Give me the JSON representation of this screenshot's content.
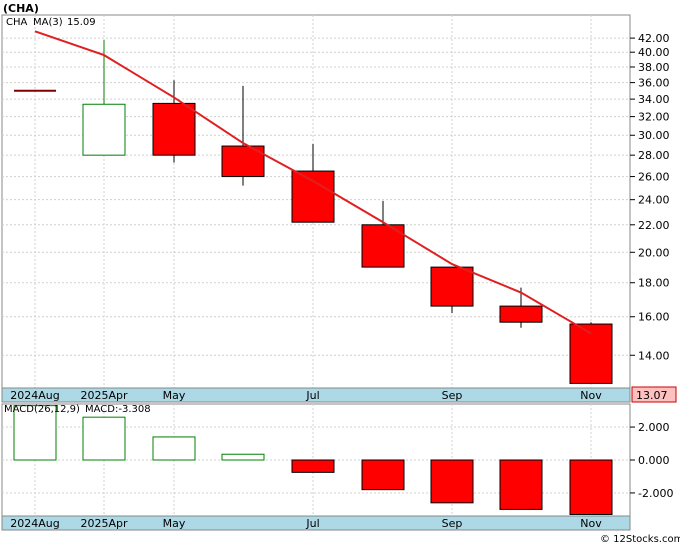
{
  "header": {
    "title": "(CHA)",
    "symbol": "CHA",
    "ma_label": "MA(3)",
    "ma_value": "15.09",
    "last_price": "13.07",
    "macd_label": "MACD(26,12,9)",
    "macd_value_label": "MACD:-3.308",
    "watermark": "© 12Stocks.com"
  },
  "colors": {
    "up_candle": "#ffffff",
    "up_border": "#008000",
    "down_candle": "#ff0000",
    "ma_line": "#e02020",
    "axis_strip": "#add8e6",
    "price_tag": "#ffc0c0",
    "grid": "#d0d0d0"
  },
  "chart_data": [
    {
      "type": "candlestick",
      "title": "(CHA)",
      "period_labels": [
        "2024Aug",
        "2025Apr",
        "May",
        "Jul",
        "Sep",
        "Nov"
      ],
      "ylim": [
        12.5,
        45.5
      ],
      "y_scale": "log",
      "y_ticks": [
        "14.00",
        "16.00",
        "18.00",
        "20.00",
        "22.00",
        "24.00",
        "26.00",
        "28.00",
        "30.00",
        "32.00",
        "34.00",
        "36.00",
        "38.00",
        "40.00",
        "42.00"
      ],
      "grid": true,
      "candles": [
        {
          "open": 35.0,
          "close": 35.0,
          "high": 35.0,
          "low": 35.0
        },
        {
          "open": 28.0,
          "close": 33.4,
          "high": 41.7,
          "low": 28.0
        },
        {
          "open": 33.5,
          "close": 28.0,
          "high": 36.3,
          "low": 27.3
        },
        {
          "open": 28.9,
          "close": 26.0,
          "high": 35.6,
          "low": 25.2
        },
        {
          "open": 26.5,
          "close": 22.2,
          "high": 29.1,
          "low": 22.2
        },
        {
          "open": 22.0,
          "close": 19.0,
          "high": 23.9,
          "low": 19.0
        },
        {
          "open": 19.0,
          "close": 16.6,
          "high": 19.0,
          "low": 16.2
        },
        {
          "open": 16.6,
          "close": 15.7,
          "high": 17.7,
          "low": 15.4
        },
        {
          "open": 15.6,
          "close": 12.7,
          "high": 15.7,
          "low": 12.7
        }
      ],
      "ma_series": {
        "name": "MA(3)",
        "points": [
          [
            0,
            43.0
          ],
          [
            1,
            39.6
          ],
          [
            2,
            34.2
          ],
          [
            3,
            29.2
          ],
          [
            4,
            25.6
          ],
          [
            5,
            22.2
          ],
          [
            6,
            19.2
          ],
          [
            7,
            17.4
          ],
          [
            8,
            15.1
          ]
        ]
      }
    },
    {
      "type": "bar",
      "title": "MACD(26,12,9)",
      "ylim": [
        -3.4,
        3.4
      ],
      "y_ticks": [
        "2.000",
        "0.000",
        "-2.000"
      ],
      "values": [
        3.3,
        2.6,
        1.4,
        0.35,
        -0.75,
        -1.8,
        -2.6,
        -3.0,
        -3.308
      ]
    }
  ]
}
